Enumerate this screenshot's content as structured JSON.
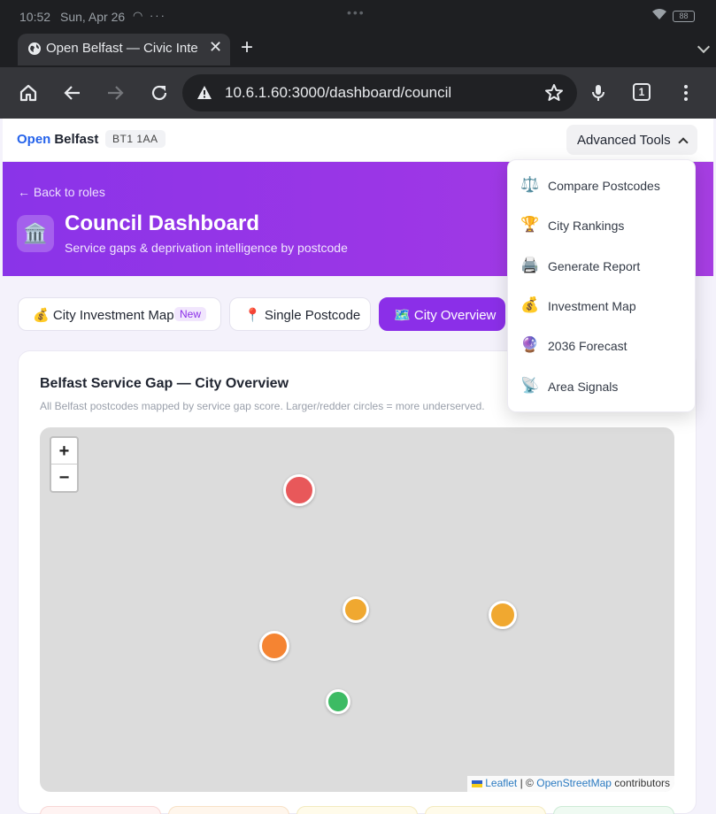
{
  "status_bar": {
    "time": "10:52",
    "date": "Sun, Apr 26",
    "battery": "88"
  },
  "browser": {
    "tab_title": "Open Belfast — Civic Intelligence",
    "url": "10.6.1.60:3000/dashboard/council",
    "tab_count": "1"
  },
  "header": {
    "brand_open": "Open",
    "brand_city": "Belfast",
    "postcode": "BT1 1AA",
    "advanced_tools_label": "Advanced Tools"
  },
  "hero": {
    "back_label": "← Back to roles",
    "icon": "🏛️",
    "title": "Council Dashboard",
    "subtitle": "Service gaps & deprivation intelligence by postcode"
  },
  "nav_tabs": [
    {
      "icon": "💰",
      "label": "City Investment Map",
      "badge": "New",
      "active": false
    },
    {
      "icon": "📍",
      "label": "Single Postcode",
      "active": false
    },
    {
      "icon": "🗺️",
      "label": "City Overview",
      "active": true
    }
  ],
  "card": {
    "title": "Belfast Service Gap — City Overview",
    "description": "All Belfast postcodes mapped by service gap score. Larger/redder circles = more underserved."
  },
  "map": {
    "zoom_in": "+",
    "zoom_out": "−",
    "attribution_leaflet": "Leaflet",
    "attribution_sep": "| ©",
    "attribution_osm": "OpenStreetMap",
    "attribution_tail": "contributors",
    "markers": [
      {
        "color": "#e8585a"
      },
      {
        "color": "#f0a830"
      },
      {
        "color": "#f0a830"
      },
      {
        "color": "#f58432"
      },
      {
        "color": "#3dbb64"
      }
    ]
  },
  "dropdown": {
    "items": [
      {
        "icon": "⚖️",
        "label": "Compare Postcodes"
      },
      {
        "icon": "🏆",
        "label": "City Rankings"
      },
      {
        "icon": "🖨️",
        "label": "Generate Report"
      },
      {
        "icon": "💰",
        "label": "Investment Map"
      },
      {
        "icon": "🔮",
        "label": "2036 Forecast"
      },
      {
        "icon": "📡",
        "label": "Area Signals"
      }
    ]
  },
  "colors": {
    "accent": "#8b2fe8",
    "brand_blue": "#2563eb"
  }
}
